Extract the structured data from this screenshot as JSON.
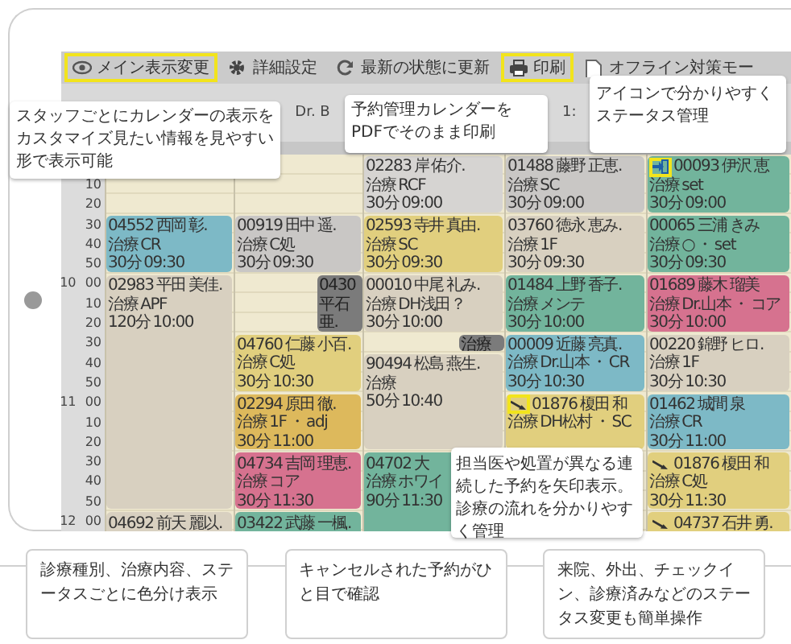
{
  "toolbar": [
    {
      "label": "メイン表示変更",
      "highlighted": true
    },
    {
      "label": "詳細設定",
      "highlighted": false
    },
    {
      "label": "最新の状態に更新",
      "highlighted": false
    },
    {
      "label": "印刷",
      "highlighted": true
    },
    {
      "label": "オフライン対策モー",
      "highlighted": false
    }
  ],
  "staff": [
    "Dr. B",
    "1:"
  ],
  "times": [
    "10",
    "20",
    "30",
    "40",
    "50",
    "10 00",
    "10",
    "20",
    "30",
    "40",
    "50",
    "11 00",
    "10",
    "20",
    "30",
    "40",
    "50",
    "12 00"
  ],
  "appointments": [
    {
      "kind": "plain",
      "color": "#7db9c6",
      "cancelled": false,
      "lines": [
        "04552 西岡 彰.",
        "治療 CR",
        "30分 09:30"
      ]
    },
    {
      "kind": "plain",
      "color": "#d8d0c0",
      "cancelled": false,
      "lines": [
        "02983 平田 美佳.",
        "治療 APF",
        "120分 10:00"
      ]
    },
    {
      "kind": "plain",
      "color": "#d8d0c0",
      "cancelled": false,
      "lines": [
        "04692 前天 麗以."
      ]
    },
    {
      "kind": "plain",
      "color": "#c9c7c5",
      "cancelled": false,
      "lines": [
        "00919 田中 遥.",
        "治療 C処",
        "30分 09:30"
      ]
    },
    {
      "kind": "plain",
      "color": "#7b7b7b",
      "cancelled": true,
      "lines": [
        "0430",
        "平石",
        "亜."
      ]
    },
    {
      "kind": "plain",
      "color": "#e1cf7e",
      "cancelled": false,
      "lines": [
        "04760 仁藤 小百.",
        "治療 C処",
        "30分 10:30"
      ]
    },
    {
      "kind": "plain",
      "color": "#ddb95c",
      "cancelled": false,
      "lines": [
        "02294 原田 徹.",
        "治療 1F ・ adj",
        "30分 11:00"
      ]
    },
    {
      "kind": "plain",
      "color": "#d6728f",
      "cancelled": false,
      "lines": [
        "04734 吉岡 理恵.",
        "治療 コア",
        "30分 11:30"
      ]
    },
    {
      "kind": "plain",
      "color": "#72b49c",
      "cancelled": false,
      "lines": [
        "03422 武藤 一楓."
      ]
    },
    {
      "kind": "plain",
      "color": "#d6d4d2",
      "cancelled": false,
      "lines": [
        "02283 岸 佑介.",
        "治療 RCF",
        "30分 09:00"
      ]
    },
    {
      "kind": "plain",
      "color": "#e1cf7e",
      "cancelled": false,
      "lines": [
        "02593 寺井 真由.",
        "治療 SC",
        "30分 09:30"
      ]
    },
    {
      "kind": "plain",
      "color": "#d8d0c0",
      "cancelled": false,
      "lines": [
        "00010 中尾 礼み.",
        "治療 DH浅田？",
        "30分 10:00"
      ]
    },
    {
      "kind": "plain",
      "color": "#7b7b7b",
      "cancelled": true,
      "lines": [
        "治療"
      ]
    },
    {
      "kind": "plain",
      "color": "#d8d0c0",
      "cancelled": false,
      "lines": [
        "90494 松島 燕生.",
        "治療",
        "50分 10:40"
      ]
    },
    {
      "kind": "plain",
      "color": "#72b49c",
      "cancelled": false,
      "lines": [
        "04702 大",
        "治療 ホワイ",
        "90分 11:30"
      ]
    },
    {
      "kind": "plain",
      "color": "#c9c7c5",
      "cancelled": false,
      "lines": [
        "01488 藤野 正恵.",
        "治療 SC",
        "30分 09:00"
      ]
    },
    {
      "kind": "plain",
      "color": "#d8d0c0",
      "cancelled": false,
      "lines": [
        "03760 徳永 恵み.",
        "治療 1F",
        "30分 09:30"
      ]
    },
    {
      "kind": "plain",
      "color": "#72b49c",
      "cancelled": false,
      "lines": [
        "01484 上野 香子.",
        "治療 メンテ",
        "30分 10:00"
      ]
    },
    {
      "kind": "plain",
      "color": "#7db9c6",
      "cancelled": false,
      "lines": [
        "00009 近藤 亮真.",
        "治療 Dr.山本 ・ CR",
        "30分 10:30"
      ]
    },
    {
      "kind": "linked",
      "color": "#e1cf7e",
      "cancelled": false,
      "highlighted": true,
      "lines": [
        "01876 榎田 和",
        "治療 DH松村 ・ SC"
      ]
    },
    {
      "kind": "check-in",
      "color": "#72b49c",
      "cancelled": false,
      "highlighted": true,
      "lines": [
        "00093 伊沢 恵",
        "治療 set",
        "30分 09:00"
      ]
    },
    {
      "kind": "plain",
      "color": "#72b49c",
      "cancelled": false,
      "lines": [
        "00065 三浦 きみ",
        "治療 ○ ・ set",
        "30分 09:30"
      ]
    },
    {
      "kind": "plain",
      "color": "#d6728f",
      "cancelled": false,
      "lines": [
        "01689 藤木 瑠美",
        "治療 Dr.山本 ・ コア",
        "30分 10:00"
      ]
    },
    {
      "kind": "plain",
      "color": "#d8d0c0",
      "cancelled": false,
      "lines": [
        "00220 錦野 ヒロ.",
        "治療 1F",
        "30分 10:30"
      ]
    },
    {
      "kind": "plain",
      "color": "#7db9c6",
      "cancelled": false,
      "lines": [
        "01462 城間 泉",
        "治療 CR",
        "30分 11:00"
      ]
    },
    {
      "kind": "linked",
      "color": "#e1cf7e",
      "cancelled": false,
      "highlighted": false,
      "lines": [
        "01876 榎田 和",
        "治療 C処",
        "30分 11:30"
      ]
    },
    {
      "kind": "linked",
      "color": "#e1cf7e",
      "cancelled": false,
      "highlighted": false,
      "lines": [
        "04737 石井 勇."
      ]
    }
  ],
  "callouts": [
    "スタッフごとにカレンダーの表示をカスタマイズ見たい情報を見やすい形で表示可能",
    "予約管理カレンダーをPDFでそのまま印刷",
    "アイコンで分かりやすくステータス管理",
    "担当医や処置が異なる連続した予約を矢印表示。診療の流れを分かりやすく管理"
  ],
  "features": [
    "診療種別、治療内容、ステータスごとに色分け表示",
    "キャンセルされた予約がひと目で確認",
    "来院、外出、チェックイン、診療済みなどのステータス変更も簡単操作"
  ]
}
